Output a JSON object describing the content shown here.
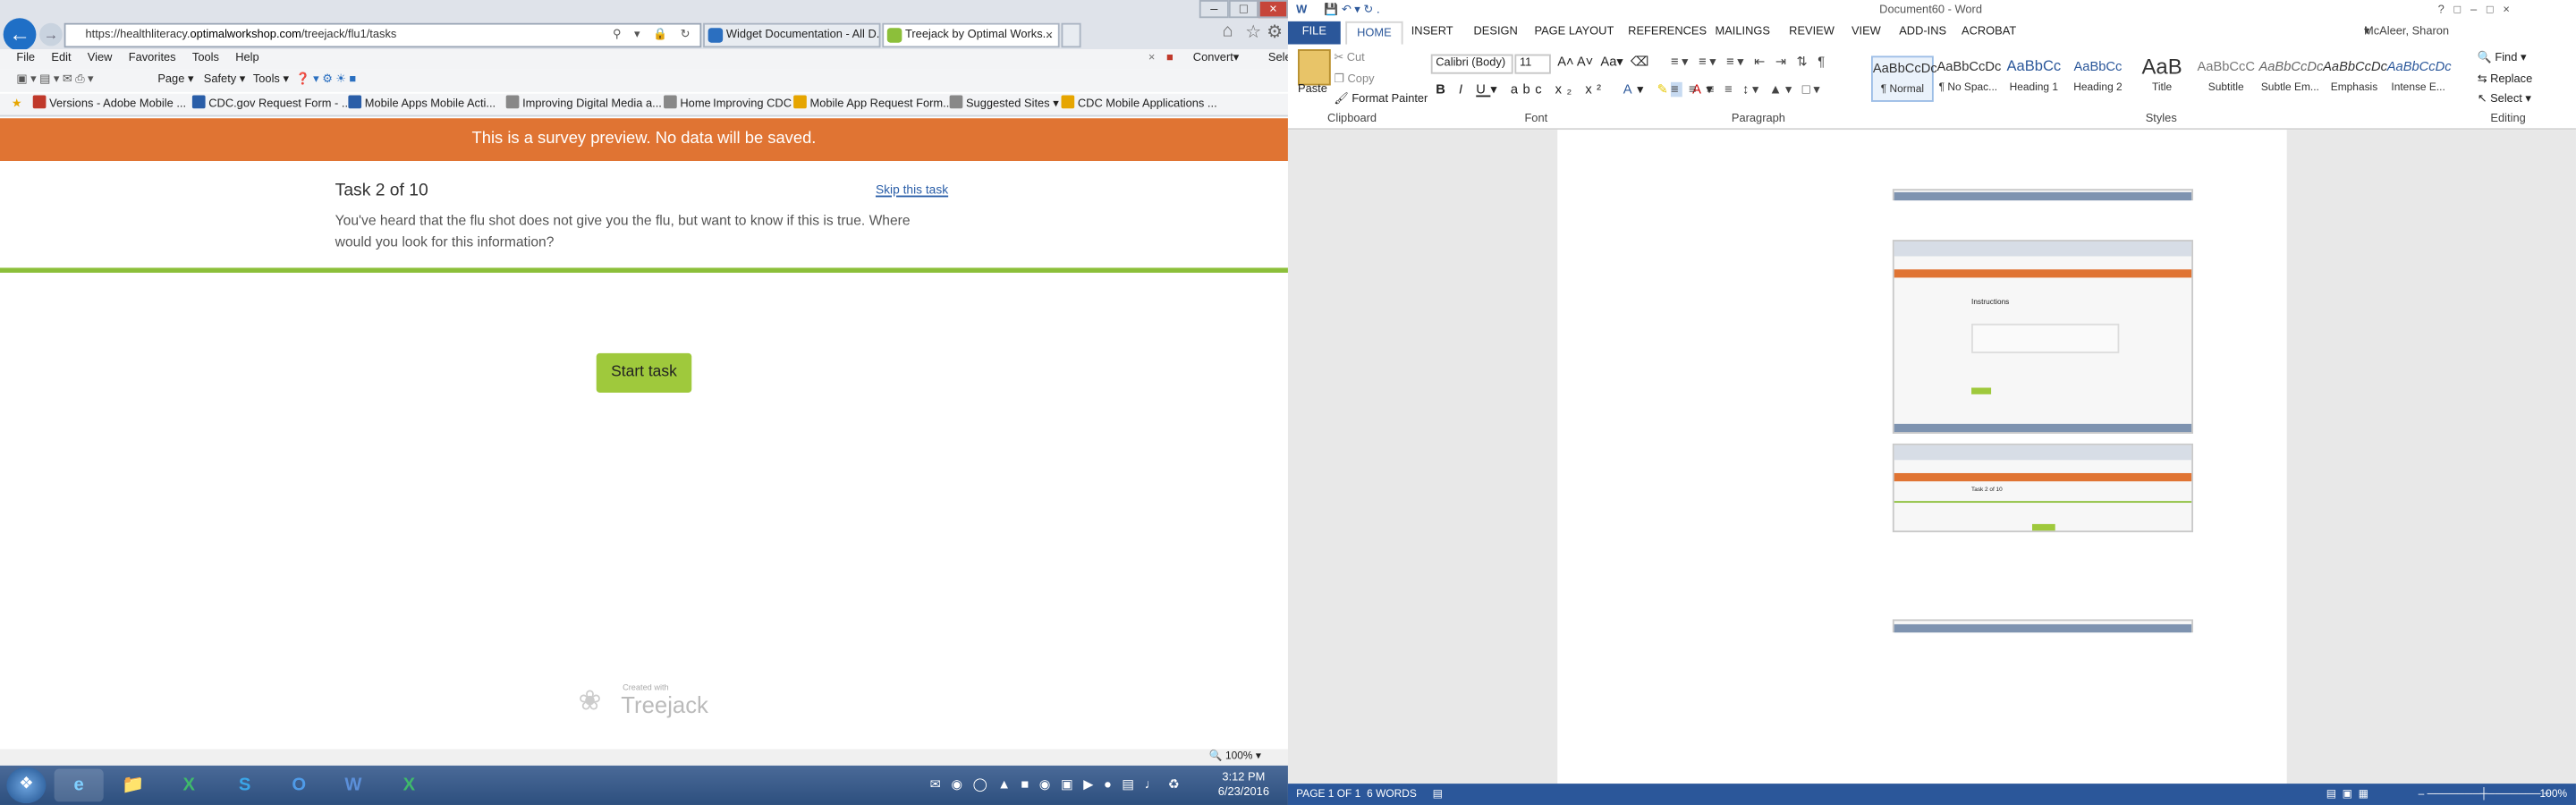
{
  "ie": {
    "url_prefix": "https://healthliteracy.",
    "url_domain": "optimalworkshop.com",
    "url_path": "/treejack/flu1/tasks",
    "tabs": [
      {
        "label": "Widget Documentation - All D..."
      },
      {
        "label": "Treejack by Optimal Works..."
      }
    ],
    "menu": [
      "File",
      "Edit",
      "View",
      "Favorites",
      "Tools",
      "Help"
    ],
    "cmd": {
      "page": "Page",
      "safety": "Safety",
      "tools": "Tools",
      "convert": "Convert",
      "select": "Select"
    },
    "favorites": [
      "Versions - Adobe Mobile ...",
      "CDC.gov Request Form - ...",
      "Mobile Apps",
      "Mobile Acti...",
      "Improving Digital Media a...",
      "Home",
      "Improving CDC",
      "Mobile App Request Form...",
      "Suggested Sites",
      "CDC Mobile Applications ..."
    ],
    "zoom": "100%"
  },
  "survey": {
    "banner": "This is a survey preview. No data will be saved.",
    "task_title": "Task 2 of 10",
    "skip": "Skip this task",
    "question": "You've heard that the flu shot does not give you the flu, but want to know if this is true. Where would you look for this information?",
    "start_button": "Start task",
    "created_with": "Created with",
    "brand": "Treejack"
  },
  "taskbar": {
    "time": "3:12 PM",
    "date": "6/23/2016"
  },
  "word": {
    "title": "Document60 - Word",
    "user": "McAleer, Sharon (CDC/OID/OADC)",
    "tabs": [
      "FILE",
      "HOME",
      "INSERT",
      "DESIGN",
      "PAGE LAYOUT",
      "REFERENCES",
      "MAILINGS",
      "REVIEW",
      "VIEW",
      "ADD-INS",
      "ACROBAT"
    ],
    "clipboard": {
      "paste": "Paste",
      "cut": "Cut",
      "copy": "Copy",
      "format_painter": "Format Painter",
      "label": "Clipboard"
    },
    "font": {
      "name": "Calibri (Body)",
      "size": "11",
      "label": "Font"
    },
    "paragraph_label": "Paragraph",
    "styles_label": "Styles",
    "editing": {
      "find": "Find",
      "replace": "Replace",
      "select": "Select",
      "label": "Editing"
    },
    "styles": [
      {
        "sample": "AaBbCcDc",
        "name": "¶ Normal"
      },
      {
        "sample": "AaBbCcDc",
        "name": "¶ No Spac..."
      },
      {
        "sample": "AaBbCc",
        "name": "Heading 1"
      },
      {
        "sample": "AaBbCc",
        "name": "Heading 2"
      },
      {
        "sample": "AaB",
        "name": "Title"
      },
      {
        "sample": "AaBbCcC",
        "name": "Subtitle"
      },
      {
        "sample": "AaBbCcDc",
        "name": "Subtle Em..."
      },
      {
        "sample": "AaBbCcDc",
        "name": "Emphasis"
      },
      {
        "sample": "AaBbCcDc",
        "name": "Intense E..."
      }
    ],
    "status": {
      "page": "PAGE 1 OF 1",
      "words": "6 WORDS",
      "zoom": "100%"
    },
    "thumb": {
      "instructions": "Instructions",
      "task": "Task 2 of 10"
    }
  },
  "colors": {
    "banner": "#e07433",
    "accent_green": "#9fc93c",
    "word_blue": "#2b579a"
  }
}
